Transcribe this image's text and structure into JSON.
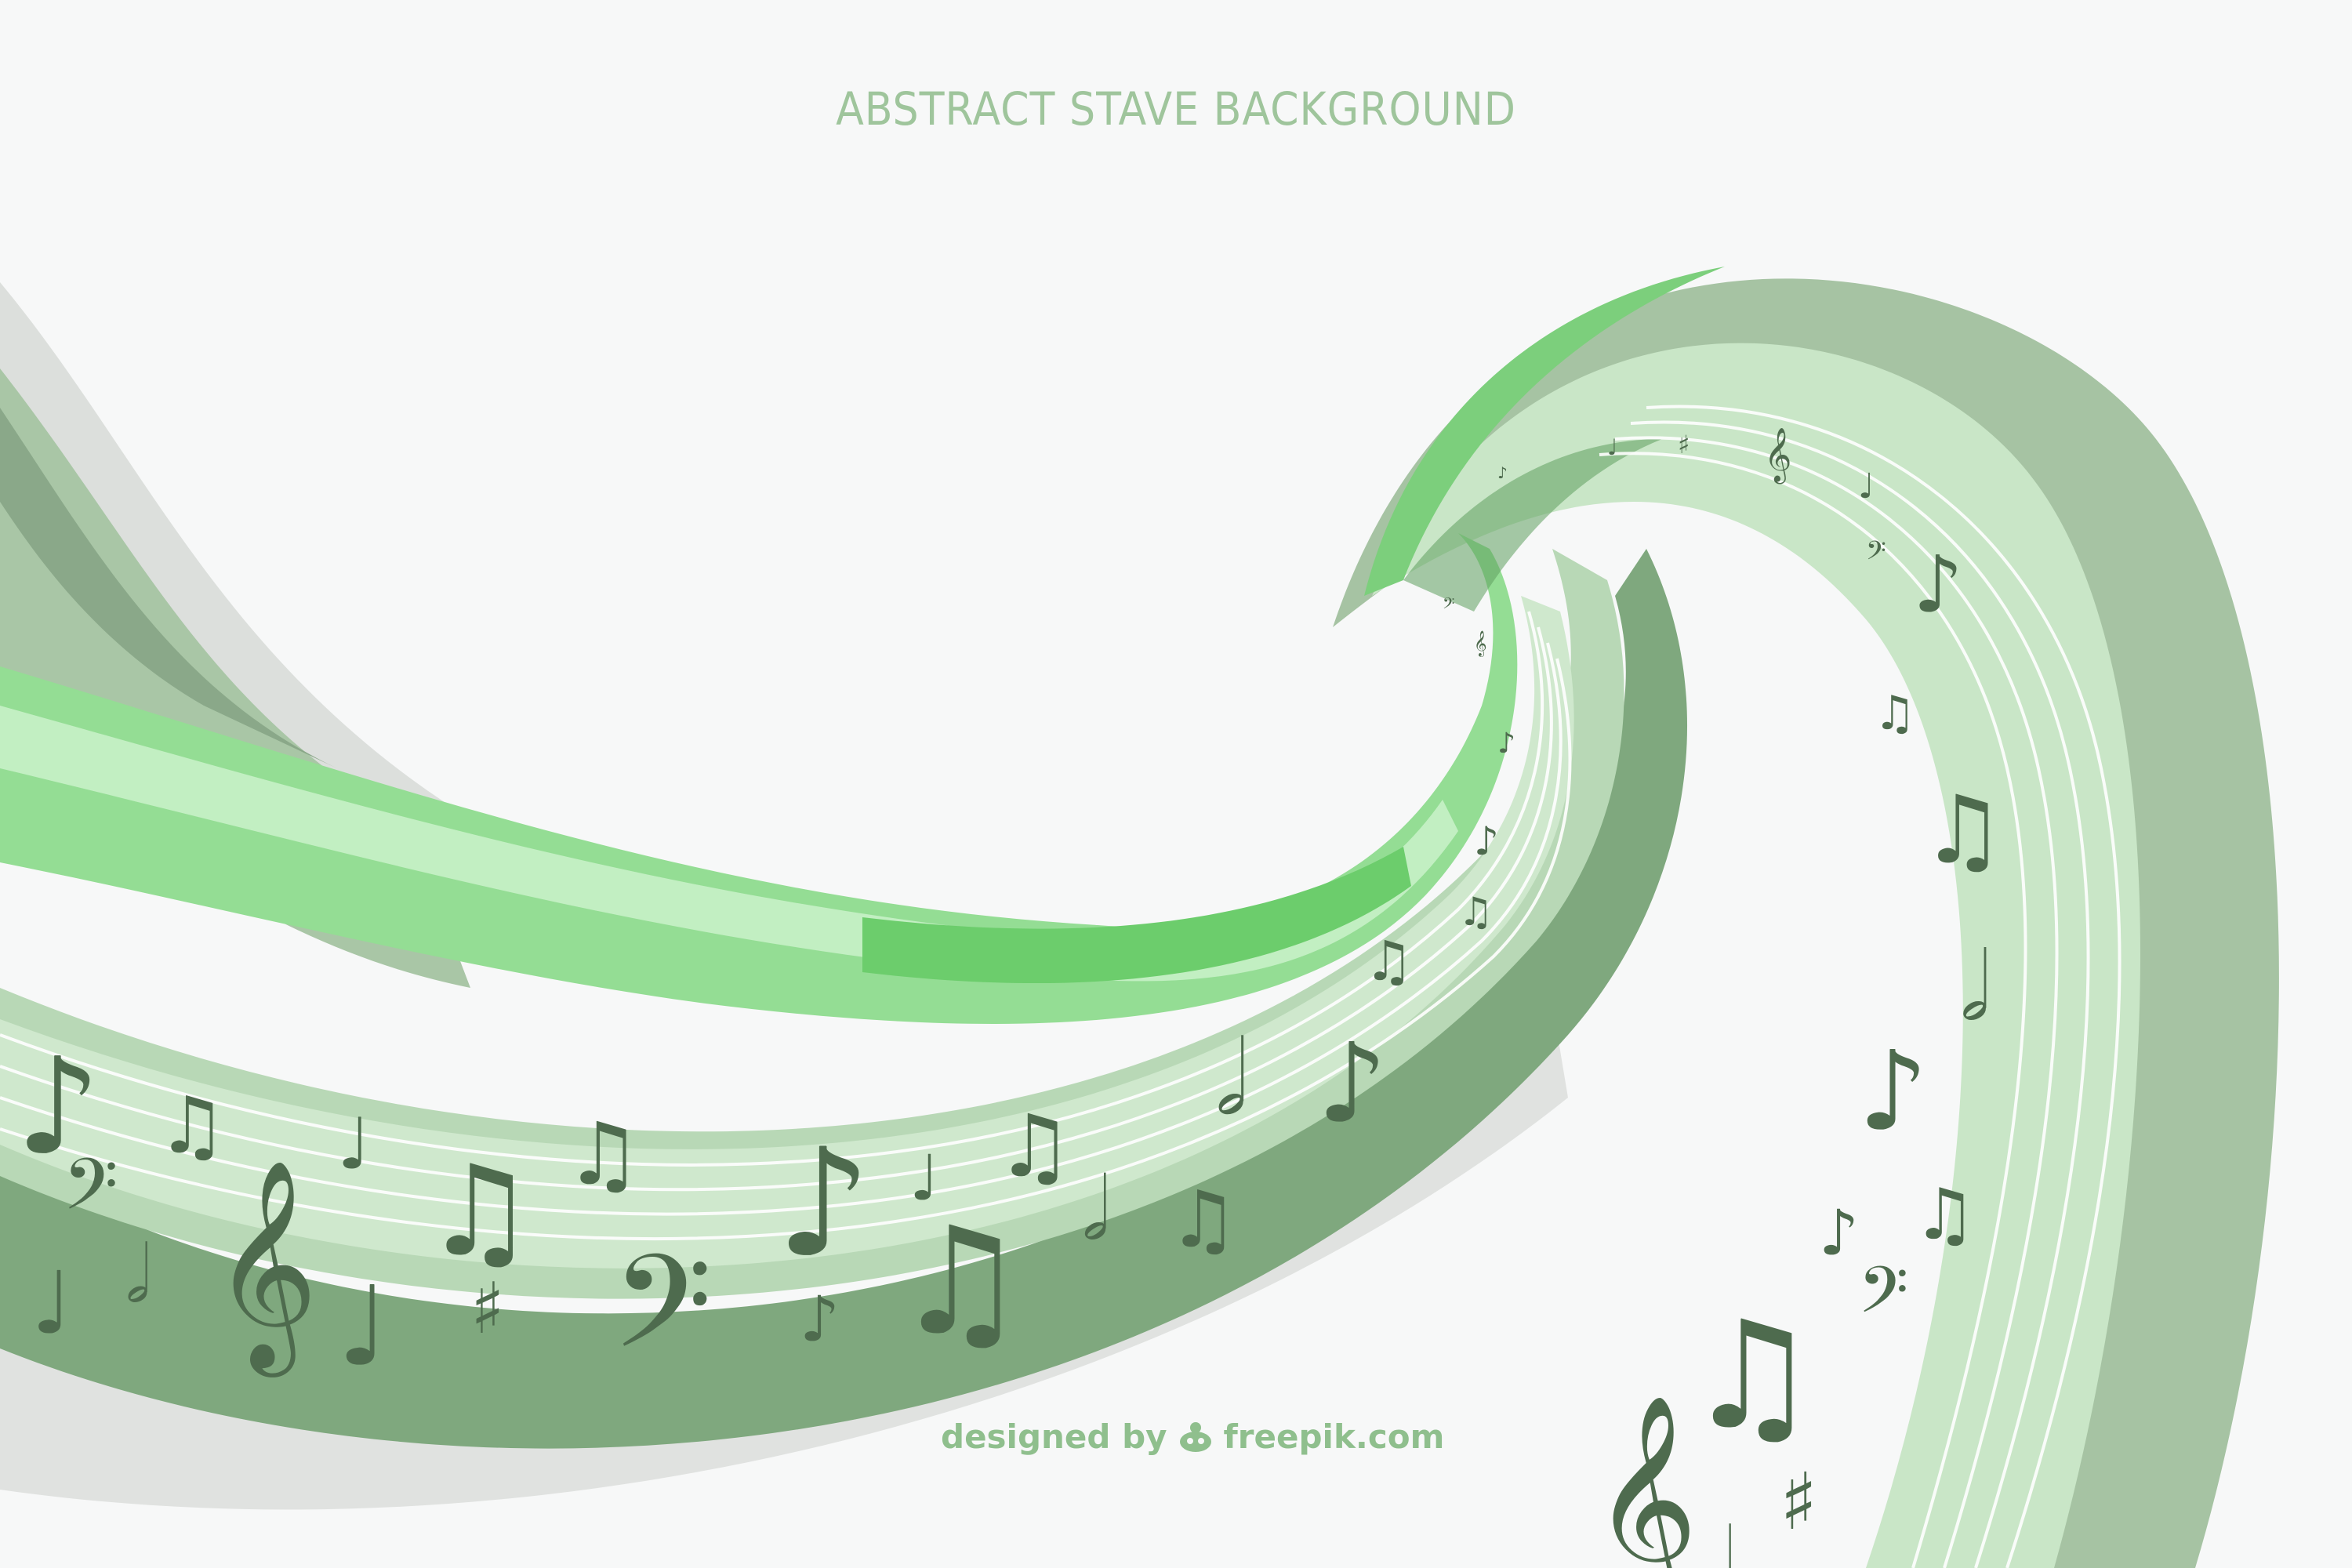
{
  "title": "ABSTRACT STAVE BACKGROUND",
  "credit": {
    "prefix": "designed by",
    "brand": "freepik.com"
  },
  "colors": {
    "background": "#f7f8f8",
    "title": "#9fc59c",
    "note": "#4e6b4e",
    "wave_light": "#c6e9c6",
    "wave_mid": "#8fd88f",
    "wave_dark": "#7ea77e",
    "wave_shadow": "#d7dbd7"
  },
  "icons": [
    "freepik-logo-icon",
    "eighth-note-icon",
    "beamed-notes-icon",
    "quarter-note-icon",
    "half-note-icon",
    "treble-clef-icon",
    "bass-clef-icon",
    "sharp-icon"
  ]
}
